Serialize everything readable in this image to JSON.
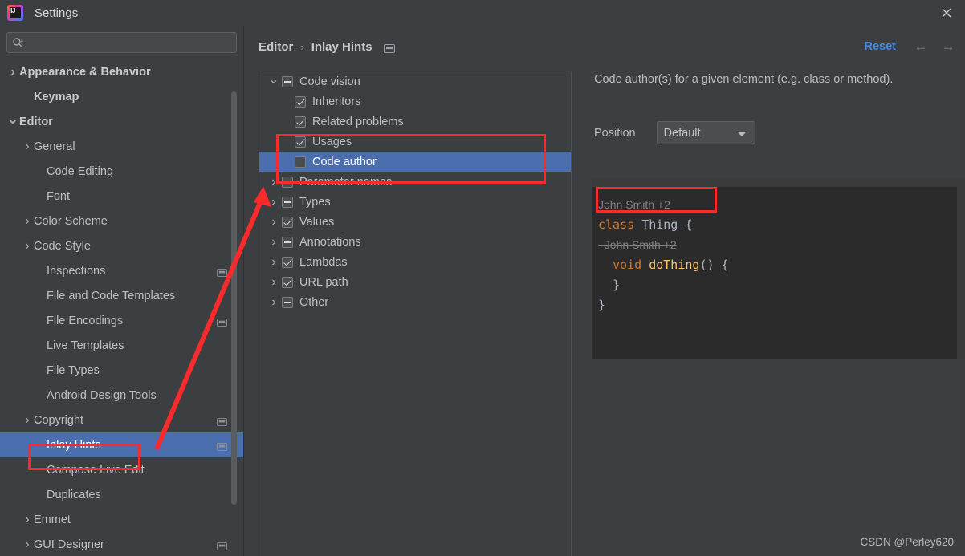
{
  "window": {
    "title": "Settings",
    "logo_icon": "intellij-idea-logo",
    "close_icon": "close-icon"
  },
  "search": {
    "placeholder": "",
    "value": "",
    "icon": "search-icon"
  },
  "sidebar": {
    "scrollbar": "vertical-scrollbar",
    "items": [
      {
        "label": "Appearance & Behavior",
        "arrow": "chevron-right-icon",
        "indent": 0,
        "bold": true,
        "selected": false,
        "gear": false
      },
      {
        "label": "Keymap",
        "arrow": "",
        "indent": 1,
        "bold": true,
        "selected": false,
        "gear": false
      },
      {
        "label": "Editor",
        "arrow": "chevron-down-icon",
        "indent": 0,
        "bold": true,
        "selected": false,
        "gear": false
      },
      {
        "label": "General",
        "arrow": "chevron-right-icon",
        "indent": 1,
        "bold": false,
        "selected": false,
        "gear": false
      },
      {
        "label": "Code Editing",
        "arrow": "",
        "indent": 2,
        "bold": false,
        "selected": false,
        "gear": false
      },
      {
        "label": "Font",
        "arrow": "",
        "indent": 2,
        "bold": false,
        "selected": false,
        "gear": false
      },
      {
        "label": "Color Scheme",
        "arrow": "chevron-right-icon",
        "indent": 1,
        "bold": false,
        "selected": false,
        "gear": false
      },
      {
        "label": "Code Style",
        "arrow": "chevron-right-icon",
        "indent": 1,
        "bold": false,
        "selected": false,
        "gear": false
      },
      {
        "label": "Inspections",
        "arrow": "",
        "indent": 2,
        "bold": false,
        "selected": false,
        "gear": true
      },
      {
        "label": "File and Code Templates",
        "arrow": "",
        "indent": 2,
        "bold": false,
        "selected": false,
        "gear": false
      },
      {
        "label": "File Encodings",
        "arrow": "",
        "indent": 2,
        "bold": false,
        "selected": false,
        "gear": true
      },
      {
        "label": "Live Templates",
        "arrow": "",
        "indent": 2,
        "bold": false,
        "selected": false,
        "gear": false
      },
      {
        "label": "File Types",
        "arrow": "",
        "indent": 2,
        "bold": false,
        "selected": false,
        "gear": false
      },
      {
        "label": "Android Design Tools",
        "arrow": "",
        "indent": 2,
        "bold": false,
        "selected": false,
        "gear": false
      },
      {
        "label": "Copyright",
        "arrow": "chevron-right-icon",
        "indent": 1,
        "bold": false,
        "selected": false,
        "gear": true
      },
      {
        "label": "Inlay Hints",
        "arrow": "",
        "indent": 2,
        "bold": false,
        "selected": true,
        "gear": true
      },
      {
        "label": "Compose Live Edit",
        "arrow": "",
        "indent": 2,
        "bold": false,
        "selected": false,
        "gear": false
      },
      {
        "label": "Duplicates",
        "arrow": "",
        "indent": 2,
        "bold": false,
        "selected": false,
        "gear": false
      },
      {
        "label": "Emmet",
        "arrow": "chevron-right-icon",
        "indent": 1,
        "bold": false,
        "selected": false,
        "gear": false
      },
      {
        "label": "GUI Designer",
        "arrow": "chevron-right-icon",
        "indent": 1,
        "bold": false,
        "selected": false,
        "gear": true
      }
    ]
  },
  "header": {
    "breadcrumb_parent": "Editor",
    "breadcrumb_separator": "›",
    "breadcrumb_current": "Inlay Hints",
    "settings_icon": "project-settings-icon",
    "reset_label": "Reset",
    "back_icon": "arrow-left-icon",
    "forward_icon": "arrow-right-icon"
  },
  "hint_tree": {
    "nodes": [
      {
        "label": "Code vision",
        "indent": 0,
        "twisty": "chevron-down-icon",
        "checkbox": "partial",
        "selected": false
      },
      {
        "label": "Inheritors",
        "indent": 1,
        "twisty": "",
        "checkbox": "checked",
        "selected": false
      },
      {
        "label": "Related problems",
        "indent": 1,
        "twisty": "",
        "checkbox": "checked",
        "selected": false
      },
      {
        "label": "Usages",
        "indent": 1,
        "twisty": "",
        "checkbox": "checked",
        "selected": false
      },
      {
        "label": "Code author",
        "indent": 1,
        "twisty": "",
        "checkbox": "unchecked",
        "selected": true
      },
      {
        "label": "Parameter names",
        "indent": 0,
        "twisty": "chevron-right-icon",
        "checkbox": "partial",
        "selected": false
      },
      {
        "label": "Types",
        "indent": 0,
        "twisty": "chevron-right-icon",
        "checkbox": "partial",
        "selected": false
      },
      {
        "label": "Values",
        "indent": 0,
        "twisty": "chevron-right-icon",
        "checkbox": "checked",
        "selected": false
      },
      {
        "label": "Annotations",
        "indent": 0,
        "twisty": "chevron-right-icon",
        "checkbox": "partial",
        "selected": false
      },
      {
        "label": "Lambdas",
        "indent": 0,
        "twisty": "chevron-right-icon",
        "checkbox": "checked",
        "selected": false
      },
      {
        "label": "URL path",
        "indent": 0,
        "twisty": "chevron-right-icon",
        "checkbox": "checked",
        "selected": false
      },
      {
        "label": "Other",
        "indent": 0,
        "twisty": "chevron-right-icon",
        "checkbox": "partial",
        "selected": false
      }
    ]
  },
  "details": {
    "description": "Code author(s) for a given element (e.g. class or method).",
    "position_label": "Position",
    "position_value": "Default",
    "position_caret": "chevron-down-icon"
  },
  "preview": {
    "lines": [
      {
        "type": "hint",
        "text": "John Smith +2",
        "indent": 0
      },
      {
        "type": "code",
        "text": "class Thing {",
        "indent": 0
      },
      {
        "type": "hint",
        "text": "John Smith +2",
        "indent": 1
      },
      {
        "type": "code",
        "text": "void doThing() {",
        "indent": 1
      },
      {
        "type": "code",
        "text": "",
        "indent": 0
      },
      {
        "type": "code",
        "text": "}",
        "indent": 1
      },
      {
        "type": "code",
        "text": "}",
        "indent": 0
      }
    ]
  },
  "watermark": {
    "text": "CSDN @Perley620"
  },
  "colors": {
    "accent_selection": "#4b6eaf",
    "link_blue": "#4a88e0",
    "annotation_red": "#fc2b2b",
    "window_bg": "#3c3f41",
    "editor_bg": "#2b2b2b",
    "keyword_orange": "#cc7832",
    "method_yellow": "#ffc66d"
  }
}
